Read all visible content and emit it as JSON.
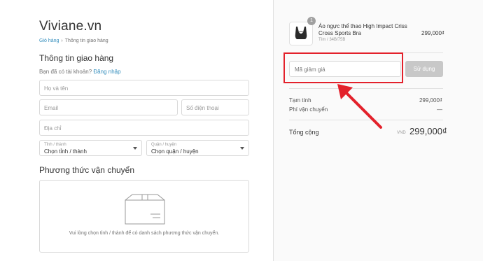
{
  "brand": "Viviane.vn",
  "breadcrumb": {
    "cart": "Giỏ hàng",
    "separator": "›",
    "current": "Thông tin giao hàng"
  },
  "shipping": {
    "heading": "Thông tin giao hàng",
    "login_prompt": "Bạn đã có tài khoản?",
    "login_link": "Đăng nhập",
    "fullname_placeholder": "Họ và tên",
    "email_placeholder": "Email",
    "phone_placeholder": "Số điện thoại",
    "address_placeholder": "Địa chỉ",
    "province": {
      "label": "Tỉnh / thành",
      "value": "Chọn tỉnh / thành"
    },
    "district": {
      "label": "Quận / huyện",
      "value": "Chọn quận / huyện"
    }
  },
  "method": {
    "heading": "Phương thức vận chuyển",
    "message": "Vui lòng chọn tỉnh / thành để có danh sách phương thức vận chuyển.",
    "icon": "package-box-icon"
  },
  "cart": {
    "item": {
      "quantity": "1",
      "name": "Áo ngực thể thao High Impact Criss Cross Sports Bra",
      "variant": "Tím / 34B/75B",
      "price": "299,000₫",
      "icon": "sports-bra-thumbnail"
    },
    "coupon_placeholder": "Mã giảm giá",
    "apply_label": "Sử dụng",
    "subtotal_label": "Tạm tính",
    "subtotal_value": "299,000₫",
    "shipping_label": "Phí vận chuyển",
    "shipping_value": "—",
    "total_label": "Tổng cộng",
    "currency": "VND",
    "total_value": "299,000₫"
  },
  "colors": {
    "link": "#338dbc",
    "highlight": "#e3212b",
    "button_disabled": "#c8c8c8"
  }
}
